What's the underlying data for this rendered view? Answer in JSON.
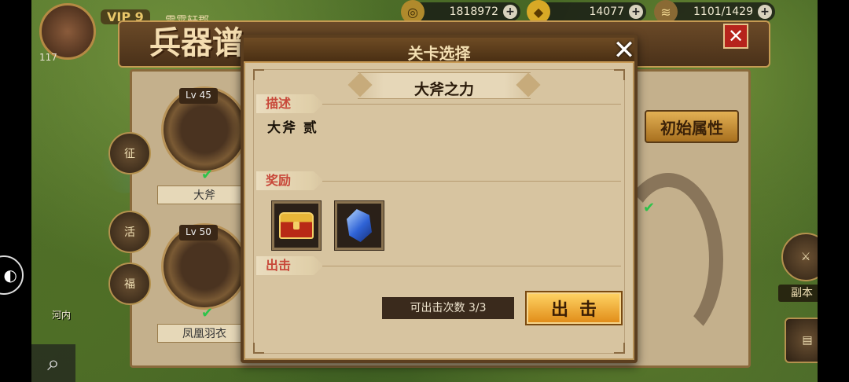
{
  "hud": {
    "player_level": "117",
    "vip": "VIP 9",
    "player_name": "雷霄轩郡",
    "resources": [
      {
        "icon": "copper-coin-icon",
        "value": "1818972"
      },
      {
        "icon": "gold-ingot-icon",
        "value": "14077"
      },
      {
        "icon": "grain-icon",
        "value": "1101/1429"
      }
    ],
    "plus": "+"
  },
  "weapon_screen": {
    "title": "兵器谱",
    "close": "✕",
    "items": [
      {
        "level_label": "Lv",
        "level": "45",
        "name": "大斧"
      },
      {
        "level_label": "Lv",
        "level": "50",
        "name": "凤凰羽衣"
      }
    ],
    "initial_attr_button": "初始属性",
    "side_buttons": [
      "征",
      "活",
      "福"
    ],
    "dungeon_label": "副本",
    "place_label": "河内"
  },
  "dialog": {
    "title": "关卡选择",
    "close": "✕",
    "stage_name": "大斧之力",
    "sections": {
      "description": "描述",
      "reward": "奖励",
      "sortie": "出击"
    },
    "description_text": "大斧 贰",
    "rewards": [
      {
        "icon": "treasure-chest-icon"
      },
      {
        "icon": "blue-crystal-icon"
      }
    ],
    "sortie_count_label": "可出击次数 3/3",
    "sortie_button": "出击"
  }
}
